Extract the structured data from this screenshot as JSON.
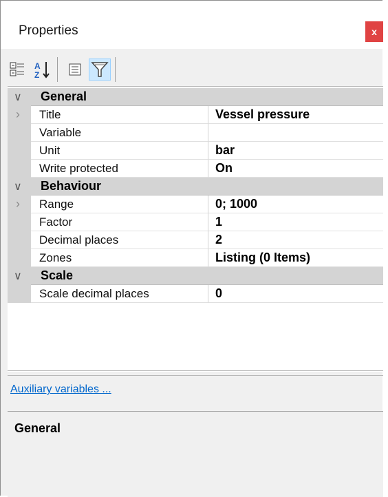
{
  "window": {
    "title": "Properties",
    "close_label": "x"
  },
  "toolbar": {
    "buttons": [
      {
        "name": "categorized-view-icon",
        "active": false
      },
      {
        "name": "alphabetical-sort-icon",
        "active": false
      },
      {
        "name": "property-pages-icon",
        "active": false
      },
      {
        "name": "filter-icon",
        "active": true
      }
    ]
  },
  "grid": {
    "categories": [
      {
        "label": "General",
        "rows": [
          {
            "name": "Title",
            "value": "Vessel pressure",
            "expandable": true
          },
          {
            "name": "Variable",
            "value": ""
          },
          {
            "name": "Unit",
            "value": "bar"
          },
          {
            "name": "Write protected",
            "value": "On"
          }
        ]
      },
      {
        "label": "Behaviour",
        "rows": [
          {
            "name": "Range",
            "value": "0; 1000",
            "expandable": true
          },
          {
            "name": "Factor",
            "value": "1"
          },
          {
            "name": "Decimal places",
            "value": "2"
          },
          {
            "name": "Zones",
            "value": "Listing (0 Items)"
          }
        ]
      },
      {
        "label": "Scale",
        "rows": [
          {
            "name": "Scale decimal places",
            "value": "0"
          }
        ]
      }
    ]
  },
  "links": {
    "auxiliary": "Auxiliary variables ..."
  },
  "description": {
    "title": "General"
  },
  "colors": {
    "close": "#e04343",
    "link": "#0066cc",
    "category_bg": "#d4d4d4",
    "active_button": "#cce8ff"
  }
}
